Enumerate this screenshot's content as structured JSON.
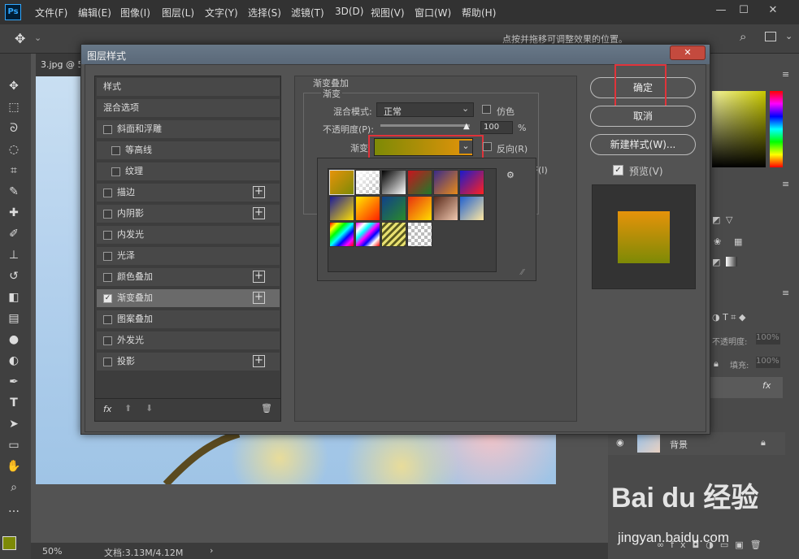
{
  "app": {
    "logo": "Ps",
    "menu": [
      "文件(F)",
      "编辑(E)",
      "图像(I)",
      "图层(L)",
      "文字(Y)",
      "选择(S)",
      "滤镜(T)",
      "3D(D)",
      "视图(V)",
      "窗口(W)",
      "帮助(H)"
    ],
    "window_controls": [
      "—",
      "☐",
      "✕"
    ]
  },
  "options": {
    "hint": "点按并拖移可调整效果的位置。"
  },
  "doc_tab": {
    "label": "3.jpg @ 5"
  },
  "status": {
    "zoom": "50%",
    "doc_size": "文档:3.13M/4.12M"
  },
  "dialog": {
    "title": "图层样式",
    "close": "✕",
    "style_list": {
      "items": [
        {
          "label": "样式",
          "checkbox": false,
          "checked": false,
          "plus": false,
          "indent": false,
          "selected": false
        },
        {
          "label": "混合选项",
          "checkbox": false,
          "checked": false,
          "plus": false,
          "indent": false,
          "selected": false
        },
        {
          "label": "斜面和浮雕",
          "checkbox": true,
          "checked": false,
          "plus": false,
          "indent": false,
          "selected": false
        },
        {
          "label": "等高线",
          "checkbox": true,
          "checked": false,
          "plus": false,
          "indent": true,
          "selected": false
        },
        {
          "label": "纹理",
          "checkbox": true,
          "checked": false,
          "plus": false,
          "indent": true,
          "selected": false
        },
        {
          "label": "描边",
          "checkbox": true,
          "checked": false,
          "plus": true,
          "indent": false,
          "selected": false
        },
        {
          "label": "内阴影",
          "checkbox": true,
          "checked": false,
          "plus": true,
          "indent": false,
          "selected": false
        },
        {
          "label": "内发光",
          "checkbox": true,
          "checked": false,
          "plus": false,
          "indent": false,
          "selected": false
        },
        {
          "label": "光泽",
          "checkbox": true,
          "checked": false,
          "plus": false,
          "indent": false,
          "selected": false
        },
        {
          "label": "颜色叠加",
          "checkbox": true,
          "checked": false,
          "plus": true,
          "indent": false,
          "selected": false
        },
        {
          "label": "渐变叠加",
          "checkbox": true,
          "checked": true,
          "plus": true,
          "indent": false,
          "selected": true
        },
        {
          "label": "图案叠加",
          "checkbox": true,
          "checked": false,
          "plus": false,
          "indent": false,
          "selected": false
        },
        {
          "label": "外发光",
          "checkbox": true,
          "checked": false,
          "plus": false,
          "indent": false,
          "selected": false
        },
        {
          "label": "投影",
          "checkbox": true,
          "checked": false,
          "plus": true,
          "indent": false,
          "selected": false
        }
      ],
      "footer_fx": "fx"
    },
    "gradient_overlay": {
      "section_title": "渐变叠加",
      "group_title": "渐变",
      "blend_label": "混合模式:",
      "blend_value": "正常",
      "dither_label": "仿色",
      "opacity_label": "不透明度(P):",
      "opacity_value": "100",
      "opacity_unit": "%",
      "gradient_label": "渐变",
      "reverse_label": "反向(R)",
      "align_partial": "齐(I)",
      "gradient_colors": [
        "#7d8a06",
        "#e6930a"
      ]
    },
    "swatches": [
      [
        "#e6930a",
        "#7d8a06"
      ],
      [
        "checker",
        "#ffffff"
      ],
      [
        "#000000",
        "#ffffff"
      ],
      [
        "#c8141e",
        "#1f7a2a"
      ],
      [
        "#3a2b8a",
        "#e88a18"
      ],
      [
        "#1a1acc",
        "#ff2020"
      ],
      [
        "#1a1a9a",
        "#ffe000"
      ],
      [
        "#ffe800",
        "#ff2000"
      ],
      [
        "#10408a",
        "#2a8a2a"
      ],
      [
        "#e83010",
        "#ffdd00"
      ],
      [
        "#5a2a1a",
        "#f0c8b0"
      ],
      [
        "#2060d0",
        "#ffe8a0"
      ],
      [
        "rainbow",
        "rainbow"
      ],
      [
        "rainbow2",
        "rainbow2"
      ],
      [
        "stripe",
        "stripe"
      ],
      [
        "checker",
        "checker"
      ]
    ],
    "buttons": {
      "ok": "确定",
      "cancel": "取消",
      "new_style": "新建样式(W)...",
      "preview_label": "预览(V)"
    },
    "preview_colors": [
      "#e6930a",
      "#7d8a06"
    ]
  },
  "right_panel": {
    "opacity_label": "不透明度:",
    "opacity_value": "100%",
    "fill_label": "填充:",
    "fill_value": "100%",
    "layer_name": "背景",
    "fx": "fx"
  },
  "watermark": {
    "brand": "Bai du 经验",
    "url": "jingyan.baidu.com"
  }
}
